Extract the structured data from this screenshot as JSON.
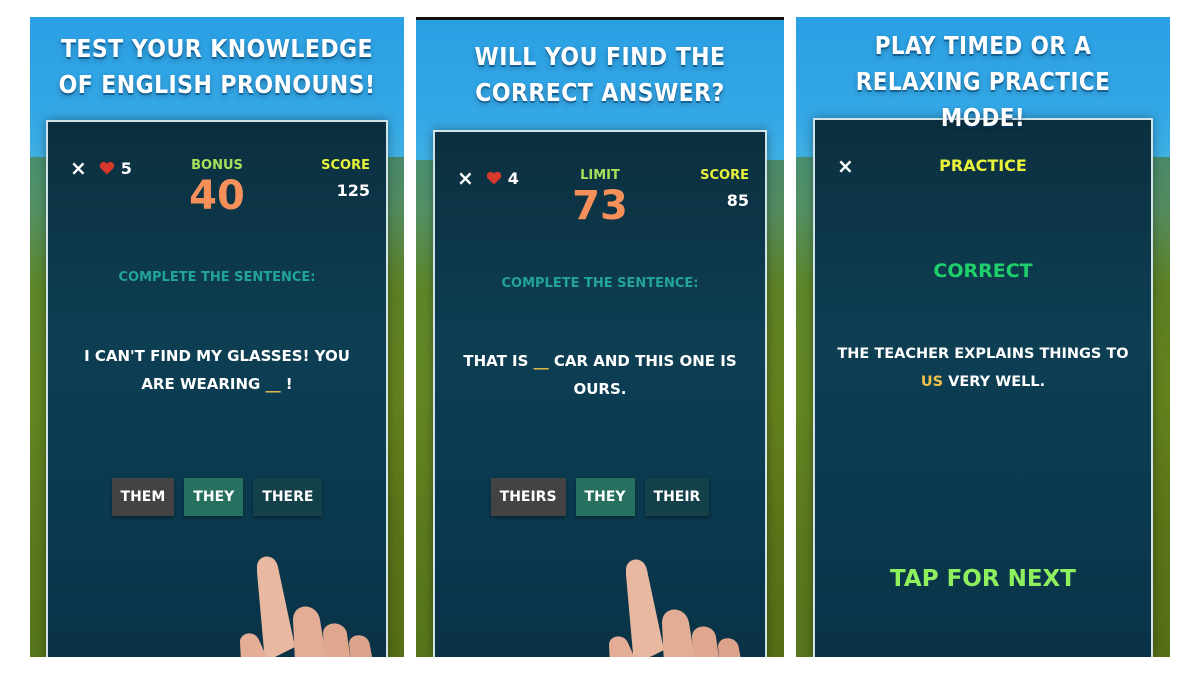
{
  "panels": [
    {
      "headline_line1": "TEST YOUR KNOWLEDGE",
      "headline_line2": "OF ENGLISH PRONOUNS!",
      "game": {
        "close_icon": "×",
        "lives": "5",
        "center_label": "BONUS",
        "center_value": "40",
        "score_label": "SCORE",
        "score_value": "125",
        "instruction": "COMPLETE THE SENTENCE:",
        "sentence_before": "I CAN'T FIND MY GLASSES! YOU ARE WEARING ",
        "blank": "__",
        "sentence_after": " !",
        "choices": [
          "THEM",
          "THEY",
          "THERE"
        ]
      }
    },
    {
      "headline_line1": "WILL YOU FIND THE",
      "headline_line2": "CORRECT ANSWER?",
      "game": {
        "close_icon": "×",
        "lives": "4",
        "center_label": "LIMIT",
        "center_value": "73",
        "score_label": "SCORE",
        "score_value": "85",
        "instruction": "COMPLETE THE SENTENCE:",
        "sentence_before": "THAT IS ",
        "blank": "__",
        "sentence_after": " CAR AND THIS ONE IS OURS.",
        "choices": [
          "THEIRS",
          "THEY",
          "THEIR"
        ]
      }
    },
    {
      "headline_line1": "PLAY TIMED OR A",
      "headline_line2": "RELAXING PRACTICE MODE!",
      "game": {
        "close_icon": "×",
        "mode_label": "PRACTICE",
        "feedback": "CORRECT",
        "sentence_before": "THE TEACHER EXPLAINS THINGS TO ",
        "highlight": "US",
        "sentence_after": " VERY WELL.",
        "tap_next": "TAP FOR NEXT"
      }
    }
  ],
  "colors": {
    "sky": "#2a9fe3",
    "screen_bg": "#0d3e52",
    "bonus_label": "#a5e15a",
    "big_number": "#f5905b",
    "score_label": "#e7f23b",
    "instruction": "#23a49a",
    "blank": "#f0c14a",
    "correct": "#1fd06a",
    "tap_next": "#8ff05e",
    "heart": "#d9382c"
  }
}
